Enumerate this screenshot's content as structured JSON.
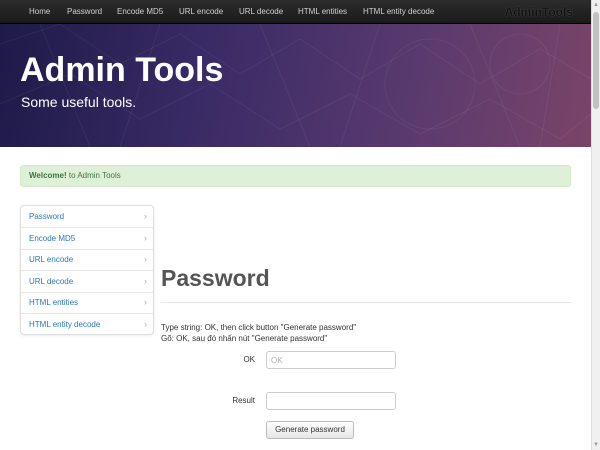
{
  "navbar": {
    "items": [
      {
        "label": "Home"
      },
      {
        "label": "Password"
      },
      {
        "label": "Encode MD5"
      },
      {
        "label": "URL encode"
      },
      {
        "label": "URL decode"
      },
      {
        "label": "HTML entities"
      },
      {
        "label": "HTML entity decode"
      }
    ],
    "brand": "AdminTools"
  },
  "hero": {
    "title": "Admin Tools",
    "subtitle": "Some useful tools."
  },
  "alert": {
    "strong": "Welcome!",
    "text": " to Admin Tools"
  },
  "sidebar": {
    "items": [
      {
        "label": "Password"
      },
      {
        "label": "Encode MD5"
      },
      {
        "label": "URL encode"
      },
      {
        "label": "URL decode"
      },
      {
        "label": "HTML entities"
      },
      {
        "label": "HTML entity decode"
      }
    ],
    "chevron": "›"
  },
  "main": {
    "title": "Password",
    "description_en": "Type string: OK, then click button \"Generate password\"",
    "description_vi": "Gõ: OK, sau đó nhấn nút \"Generate password\"",
    "input_label": "OK",
    "input_placeholder": "OK",
    "input_value": "",
    "result_label": "Result",
    "result_value": "",
    "button_label": "Generate password"
  },
  "colors": {
    "navbar": "#1f1f1f",
    "hero_start": "#1e1a48",
    "hero_end": "#7a4468",
    "link": "#2a77b8",
    "alert_bg": "#dff0d8",
    "alert_text": "#3c763d"
  }
}
